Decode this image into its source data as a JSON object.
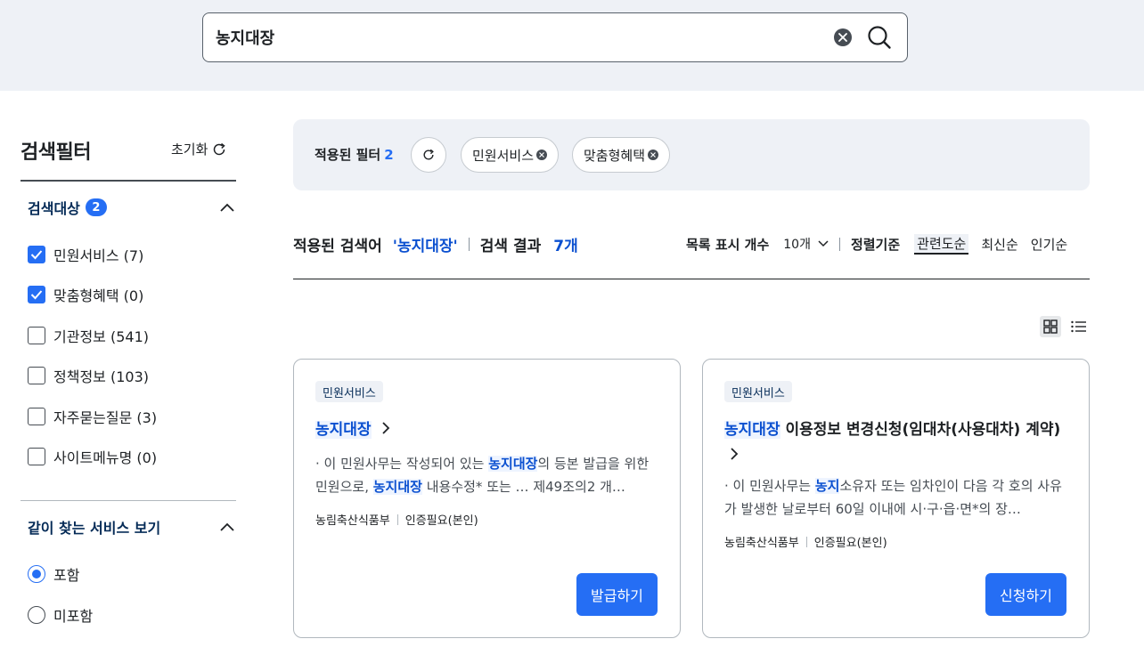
{
  "search": {
    "query": "농지대장"
  },
  "sidebar": {
    "title": "검색필터",
    "reset_label": "초기화",
    "target_section": {
      "label": "검색대상",
      "count": "2",
      "options": [
        {
          "label": "민원서비스 (7)",
          "checked": true
        },
        {
          "label": "맞춤형혜택 (0)",
          "checked": true
        },
        {
          "label": "기관정보 (541)",
          "checked": false
        },
        {
          "label": "정책정보 (103)",
          "checked": false
        },
        {
          "label": "자주묻는질문 (3)",
          "checked": false
        },
        {
          "label": "사이트메뉴명 (0)",
          "checked": false
        }
      ]
    },
    "related_section": {
      "label": "같이 찾는 서비스 보기",
      "options": [
        {
          "label": "포함",
          "selected": true
        },
        {
          "label": "미포함",
          "selected": false
        }
      ]
    }
  },
  "applied_filters": {
    "label": "적용된 필터",
    "count": "2",
    "chips": [
      "민원서비스",
      "맞춤형혜택"
    ]
  },
  "results": {
    "applied_query_label": "적용된 검색어",
    "applied_query": "'농지대장'",
    "result_label": "검색 결과",
    "result_count": "7개",
    "page_size_label": "목록 표시 개수",
    "page_size_value": "10개",
    "sort_label": "정렬기준",
    "sort_options": [
      "관련도순",
      "최신순",
      "인기순"
    ],
    "active_sort": "관련도순"
  },
  "cards": [
    {
      "tag": "민원서비스",
      "title_hl": "농지대장",
      "title_rest": "",
      "desc_1": "· 이 민원사무는 작성되어 있는 ",
      "desc_hl_1": "농지대장",
      "desc_2": "의 등본 발급을 위한 민원으로, ",
      "desc_hl_2": "농지대장",
      "desc_3": " 내용수정* 또는 … 제49조의2 개…",
      "agency": "농림축산식품부",
      "auth": "인증필요(본인)",
      "button": "발급하기"
    },
    {
      "tag": "민원서비스",
      "title_hl": "농지대장",
      "title_rest": " 이용정보 변경신청(임대차(사용대차) 계약)",
      "desc_1": "· 이 민원사무는 ",
      "desc_hl_1": "농지",
      "desc_2": "소유자 또는 임차인이 다음 각 호의 사유가 발생한 날로부터 60일 이내에 시·구·읍·면*의 장…",
      "desc_hl_2": "",
      "desc_3": "",
      "agency": "농림축산식품부",
      "auth": "인증필요(본인)",
      "button": "신청하기"
    }
  ],
  "colors": {
    "accent": "#256ef4",
    "highlight_text": "#0b50d0",
    "panel_bg": "#eef1f6"
  }
}
